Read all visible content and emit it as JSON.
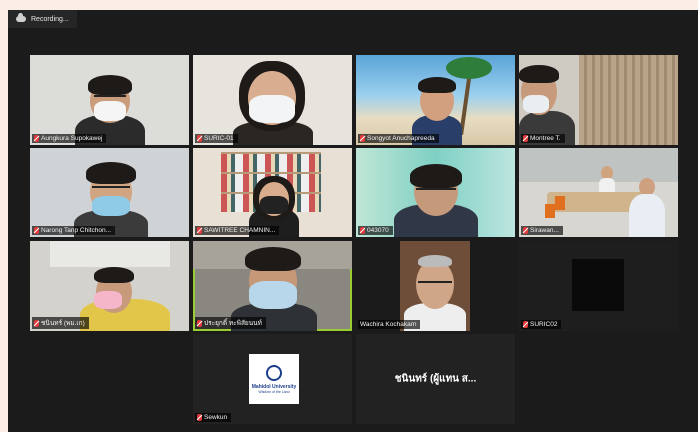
{
  "recording": {
    "label": "Recording..."
  },
  "participants": [
    {
      "name": "Aungkura Supokawej"
    },
    {
      "name": "SURIC-01"
    },
    {
      "name": "Songyot Anuchapreeda"
    },
    {
      "name": "Montree T."
    },
    {
      "name": "Narong Tanp Chitchon..."
    },
    {
      "name": "SAWITREE CHAMNIN..."
    },
    {
      "name": "043070"
    },
    {
      "name": "Sirawan..."
    },
    {
      "name": "ชนินทร์ (พม.เก)"
    },
    {
      "name": "ประยุกติ์ ทะพิสัยนนท์"
    },
    {
      "name": "Wachira Kochakarn"
    },
    {
      "name": "SURIC02"
    },
    {
      "name": "Sewkun",
      "logo_line1": "Mahidol University",
      "logo_line2": "Wisdom of the Land"
    },
    {
      "name": "ชนินทร์ (ผู้แทน ส...",
      "display_text": "ชนินทร์ (ผู้แทน ส..."
    }
  ]
}
